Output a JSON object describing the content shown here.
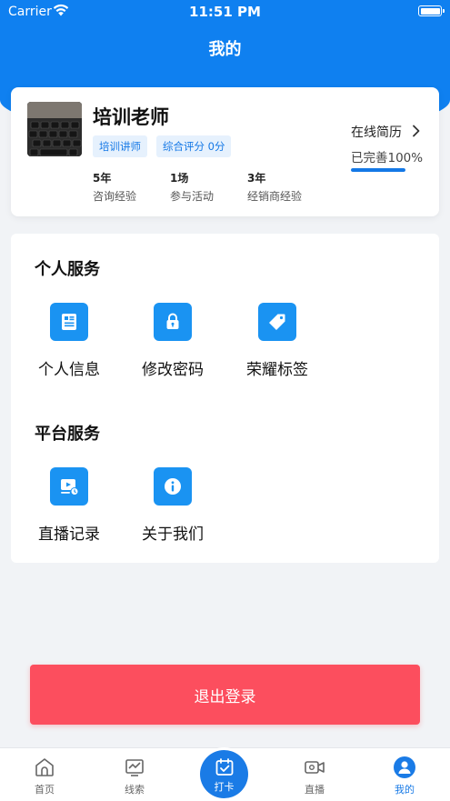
{
  "status_bar": {
    "carrier": "Carrier",
    "time": "11:51 PM"
  },
  "header": {
    "title": "我的"
  },
  "profile": {
    "name": "培训老师",
    "role_tag": "培训讲师",
    "score_tag": "综合评分 0分",
    "stats": [
      {
        "value": "5年",
        "label": "咨询经验"
      },
      {
        "value": "1场",
        "label": "参与活动"
      },
      {
        "value": "3年",
        "label": "经销商经验"
      }
    ],
    "resume_link": "在线简历",
    "resume_progress_text": "已完善100%",
    "resume_progress": 1.0
  },
  "personal_services": {
    "title": "个人服务",
    "items": [
      {
        "label": "个人信息",
        "icon": "id-card-icon"
      },
      {
        "label": "修改密码",
        "icon": "lock-icon"
      },
      {
        "label": "荣耀标签",
        "icon": "tag-icon"
      }
    ]
  },
  "platform_services": {
    "title": "平台服务",
    "items": [
      {
        "label": "直播记录",
        "icon": "video-record-icon"
      },
      {
        "label": "关于我们",
        "icon": "info-icon"
      }
    ]
  },
  "logout_label": "退出登录",
  "tab_bar": {
    "items": [
      {
        "label": "首页",
        "icon": "home-icon",
        "active": false
      },
      {
        "label": "线索",
        "icon": "chart-icon",
        "active": false
      },
      {
        "label": "打卡",
        "icon": "checkin-icon",
        "active": false
      },
      {
        "label": "直播",
        "icon": "video-camera-icon",
        "active": false
      },
      {
        "label": "我的",
        "icon": "user-icon",
        "active": true
      }
    ]
  },
  "colors": {
    "primary": "#0f80f0",
    "accent": "#1a93f2",
    "logout": "#fc4e5e"
  }
}
